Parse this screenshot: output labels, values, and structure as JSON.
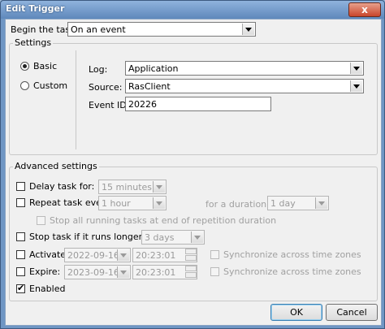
{
  "window": {
    "title": "Edit Trigger",
    "close_glyph": "x"
  },
  "begin": {
    "label": "Begin the task:",
    "value": "On an event"
  },
  "settings": {
    "title": "Settings",
    "basic_label": "Basic",
    "custom_label": "Custom",
    "log_label": "Log:",
    "log_value": "Application",
    "source_label": "Source:",
    "source_value": "RasClient",
    "event_id_label": "Event ID:",
    "event_id_value": "20226"
  },
  "advanced": {
    "title": "Advanced settings",
    "delay_label": "Delay task for:",
    "delay_value": "15 minutes",
    "repeat_label": "Repeat task every:",
    "repeat_value": "1 hour",
    "duration_label": "for a duration of:",
    "duration_value": "1 day",
    "stop_all_label": "Stop all running tasks at end of repetition duration",
    "stop_if_label": "Stop task if it runs longer than:",
    "stop_if_value": "3 days",
    "activate_label": "Activate:",
    "activate_date": "2022-09-16",
    "activate_time": "20:23:01",
    "expire_label": "Expire:",
    "expire_date": "2023-09-16",
    "expire_time": "20:23:01",
    "sync_label": "Synchronize across time zones",
    "enabled_label": "Enabled"
  },
  "buttons": {
    "ok": "OK",
    "cancel": "Cancel"
  }
}
